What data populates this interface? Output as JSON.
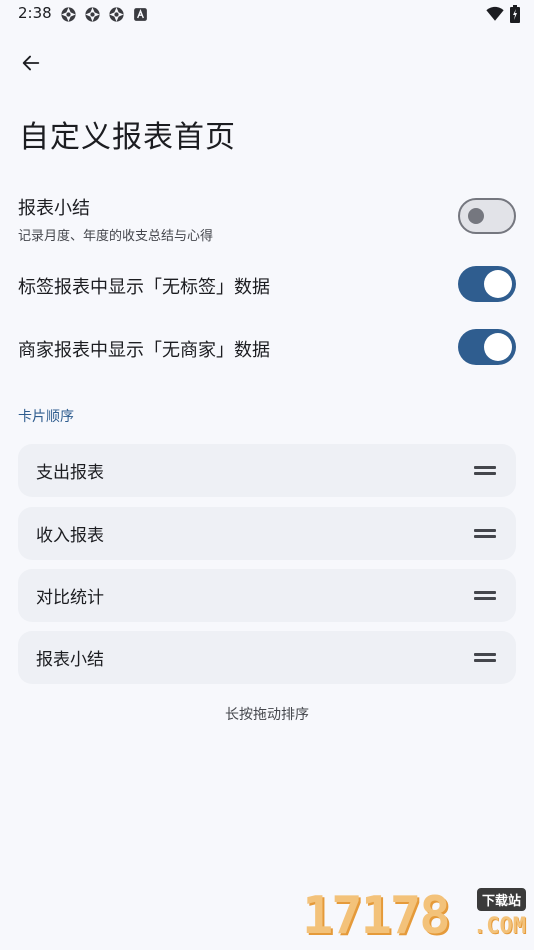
{
  "status_bar": {
    "time": "2:38",
    "notification_icons": [
      "aperture-icon",
      "aperture-icon",
      "aperture-icon",
      "a-badge-icon"
    ],
    "right_icons": [
      "wifi-icon",
      "battery-icon"
    ]
  },
  "header": {
    "back_icon": "arrow-left-icon",
    "title": "自定义报表首页"
  },
  "settings": [
    {
      "title": "报表小结",
      "subtitle": "记录月度、年度的收支总结与心得",
      "enabled": false
    },
    {
      "title": "标签报表中显示「无标签」数据",
      "enabled": true
    },
    {
      "title": "商家报表中显示「无商家」数据",
      "enabled": true
    }
  ],
  "card_order": {
    "section_title": "卡片顺序",
    "cards": [
      "支出报表",
      "收入报表",
      "对比统计",
      "报表小结"
    ],
    "hint": "长按拖动排序"
  },
  "watermark": {
    "digits": "17178",
    "badge": "下载站",
    "suffix": ".COM"
  },
  "colors": {
    "accent": "#2f5d8f",
    "background": "#f7f8fc",
    "card": "#eef0f5"
  }
}
